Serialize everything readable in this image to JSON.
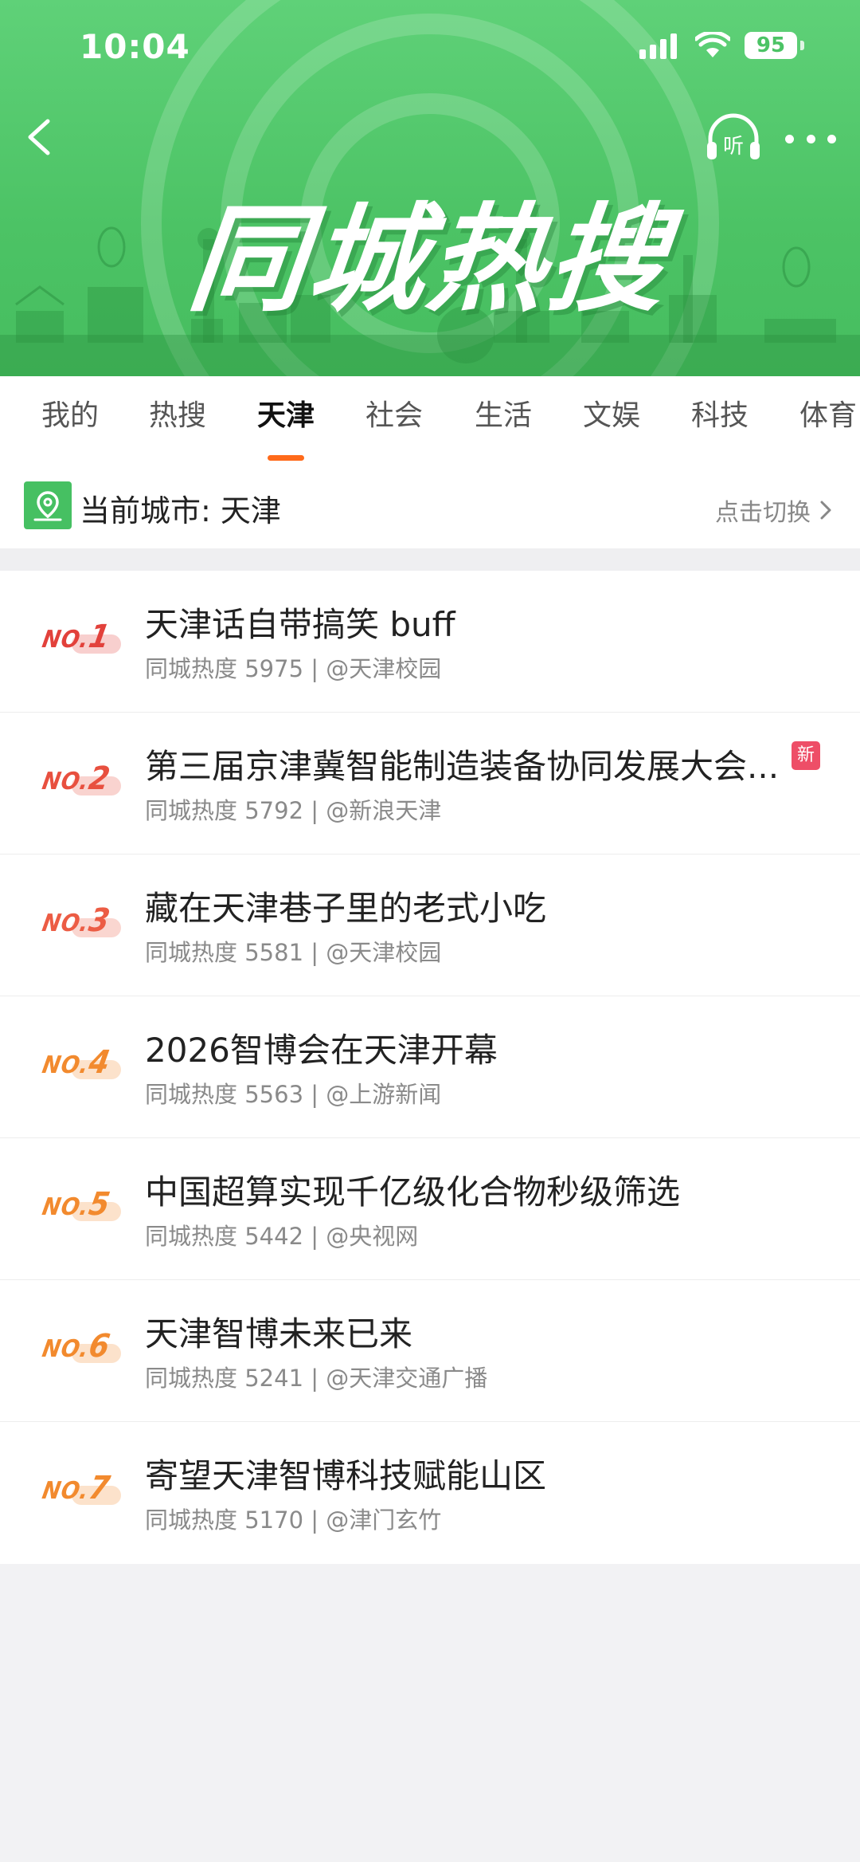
{
  "status_bar": {
    "time": "10:04",
    "battery": "95"
  },
  "header": {
    "banner_title": "同城热搜"
  },
  "tabs": [
    {
      "label": "我的",
      "active": false
    },
    {
      "label": "热搜",
      "active": false
    },
    {
      "label": "天津",
      "active": true
    },
    {
      "label": "社会",
      "active": false
    },
    {
      "label": "生活",
      "active": false
    },
    {
      "label": "文娱",
      "active": false
    },
    {
      "label": "科技",
      "active": false
    },
    {
      "label": "体育",
      "active": false
    }
  ],
  "city": {
    "label": "当前城市: 天津",
    "switch_label": "点击切换"
  },
  "colors": {
    "header_green": "#4cc365",
    "tab_indicator": "#ff6a1a",
    "badge_new": "#ee4e67"
  },
  "items": [
    {
      "rank_prefix": "NO.",
      "rank": "1",
      "rank_color": "#e2413b",
      "title": "天津话自带搞笑 buff",
      "meta": "同城热度 5975 | @天津校园",
      "badge": ""
    },
    {
      "rank_prefix": "NO.",
      "rank": "2",
      "rank_color": "#e8503f",
      "title": "第三届京津冀智能制造装备协同发展大会...",
      "meta": "同城热度 5792 | @新浪天津",
      "badge": "新"
    },
    {
      "rank_prefix": "NO.",
      "rank": "3",
      "rank_color": "#ec5c44",
      "title": "藏在天津巷子里的老式小吃",
      "meta": "同城热度 5581 | @天津校园",
      "badge": ""
    },
    {
      "rank_prefix": "NO.",
      "rank": "4",
      "rank_color": "#f28a2e",
      "title": "2026智博会在天津开幕",
      "meta": "同城热度 5563 | @上游新闻",
      "badge": ""
    },
    {
      "rank_prefix": "NO.",
      "rank": "5",
      "rank_color": "#f28a2e",
      "title": "中国超算实现千亿级化合物秒级筛选",
      "meta": "同城热度 5442 | @央视网",
      "badge": ""
    },
    {
      "rank_prefix": "NO.",
      "rank": "6",
      "rank_color": "#f28a2e",
      "title": "天津智博未来已来",
      "meta": "同城热度 5241 | @天津交通广播",
      "badge": ""
    },
    {
      "rank_prefix": "NO.",
      "rank": "7",
      "rank_color": "#f28a2e",
      "title": "寄望天津智博科技赋能山区",
      "meta": "同城热度 5170 | @津门玄竹",
      "badge": ""
    }
  ],
  "icons": {
    "back": "chevron-left-icon",
    "listen": "headphones-listen-icon",
    "more": "more-dots-icon",
    "location": "location-pin-icon",
    "switch": "chevron-right-icon"
  }
}
